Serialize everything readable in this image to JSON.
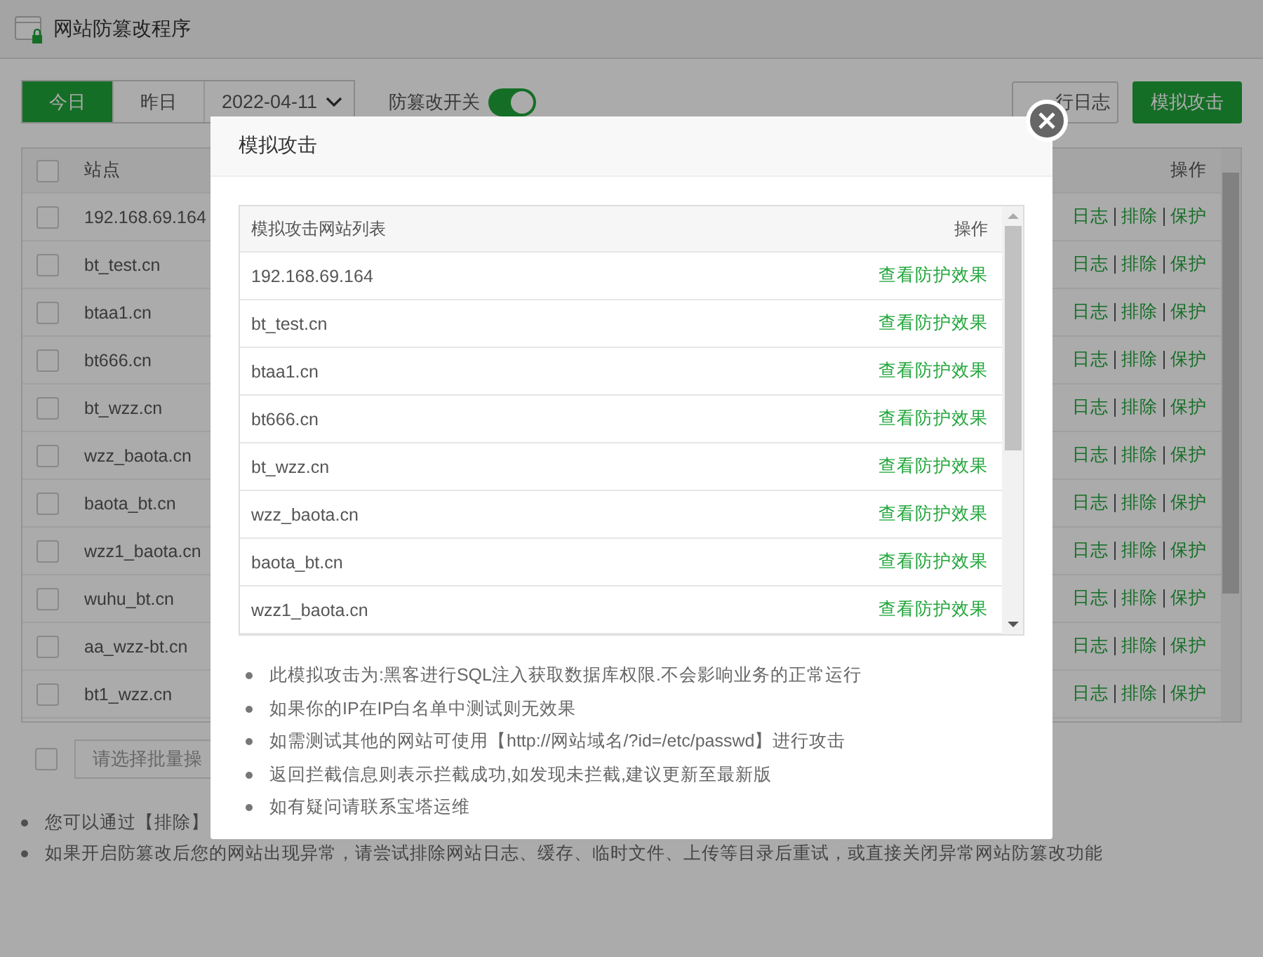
{
  "window": {
    "title": "网站防篡改程序"
  },
  "toolbar": {
    "date_tabs": [
      {
        "label": "今日",
        "selected": true
      },
      {
        "label": "昨日",
        "selected": false
      }
    ],
    "date_select": {
      "value": "2022-04-11"
    },
    "switch": {
      "label": "防篡改开关",
      "on": true
    },
    "buttons": [
      {
        "label": "行日志",
        "kind": "default"
      },
      {
        "label": "模拟攻击",
        "kind": "primary"
      }
    ]
  },
  "table": {
    "columns": [
      "站点",
      "操作"
    ],
    "all_checked": false,
    "rows": [
      {
        "site": "192.168.69.164",
        "checked": false,
        "actions": [
          "日志",
          "排除",
          "保护"
        ]
      },
      {
        "site": "bt_test.cn",
        "checked": false,
        "actions": [
          "日志",
          "排除",
          "保护"
        ]
      },
      {
        "site": "btaa1.cn",
        "checked": false,
        "actions": [
          "日志",
          "排除",
          "保护"
        ]
      },
      {
        "site": "bt666.cn",
        "checked": false,
        "actions": [
          "日志",
          "排除",
          "保护"
        ]
      },
      {
        "site": "bt_wzz.cn",
        "checked": false,
        "actions": [
          "日志",
          "排除",
          "保护"
        ]
      },
      {
        "site": "wzz_baota.cn",
        "checked": false,
        "actions": [
          "日志",
          "排除",
          "保护"
        ]
      },
      {
        "site": "baota_bt.cn",
        "checked": false,
        "actions": [
          "日志",
          "排除",
          "保护"
        ]
      },
      {
        "site": "wzz1_baota.cn",
        "checked": false,
        "actions": [
          "日志",
          "排除",
          "保护"
        ]
      },
      {
        "site": "wuhu_bt.cn",
        "checked": false,
        "actions": [
          "日志",
          "排除",
          "保护"
        ]
      },
      {
        "site": "aa_wzz-bt.cn",
        "checked": false,
        "actions": [
          "日志",
          "排除",
          "保护"
        ]
      },
      {
        "site": "bt1_wzz.cn",
        "checked": false,
        "actions": [
          "日志",
          "排除",
          "保护"
        ]
      }
    ]
  },
  "batch": {
    "checked": false,
    "placeholder": "请选择批量操"
  },
  "notes": [
    "您可以通过【排除】",
    "如果开启防篡改后您的网站出现异常，请尝试排除网站日志、缓存、临时文件、上传等目录后重试，或直接关闭异常网站防篡改功能"
  ],
  "dialog": {
    "title": "模拟攻击",
    "table": {
      "columns": [
        "模拟攻击网站列表",
        "操作"
      ],
      "rows": [
        {
          "site": "192.168.69.164",
          "action": "查看防护效果"
        },
        {
          "site": "bt_test.cn",
          "action": "查看防护效果"
        },
        {
          "site": "btaa1.cn",
          "action": "查看防护效果"
        },
        {
          "site": "bt666.cn",
          "action": "查看防护效果"
        },
        {
          "site": "bt_wzz.cn",
          "action": "查看防护效果"
        },
        {
          "site": "wzz_baota.cn",
          "action": "查看防护效果"
        },
        {
          "site": "baota_bt.cn",
          "action": "查看防护效果"
        },
        {
          "site": "wzz1_baota.cn",
          "action": "查看防护效果"
        }
      ]
    },
    "notes": [
      "此模拟攻击为:黑客进行SQL注入获取数据库权限.不会影响业务的正常运行",
      "如果你的IP在IP白名单中测试则无效果",
      "如需测试其他的网站可使用【http://网站域名/?id=/etc/passwd】进行攻击",
      "返回拦截信息则表示拦截成功,如发现未拦截,建议更新至最新版",
      "如有疑问请联系宝塔运维"
    ]
  }
}
